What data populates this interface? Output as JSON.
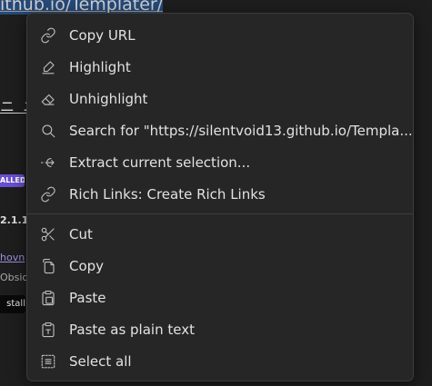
{
  "background": {
    "url_text": "ithub.io/Templater/",
    "dashes": "ニ ニ",
    "badge": "ALLED",
    "version": "2.1.1)",
    "author": "hovn",
    "obsidian": "Obsic",
    "install": "stall"
  },
  "menu": {
    "group1": [
      {
        "label": "Copy URL",
        "icon": "link-icon"
      },
      {
        "label": "Highlight",
        "icon": "highlighter-icon"
      },
      {
        "label": "Unhighlight",
        "icon": "eraser-icon"
      },
      {
        "label": "Search for \"https://silentvoid13.github.io/Templa...\"",
        "icon": "search-icon"
      },
      {
        "label": "Extract current selection...",
        "icon": "extract-icon"
      },
      {
        "label": "Rich Links: Create Rich Links",
        "icon": "link-icon"
      }
    ],
    "group2": [
      {
        "label": "Cut",
        "icon": "scissors-icon"
      },
      {
        "label": "Copy",
        "icon": "copy-icon"
      },
      {
        "label": "Paste",
        "icon": "clipboard-icon"
      },
      {
        "label": "Paste as plain text",
        "icon": "clipboard-text-icon"
      },
      {
        "label": "Select all",
        "icon": "select-all-icon"
      }
    ]
  }
}
